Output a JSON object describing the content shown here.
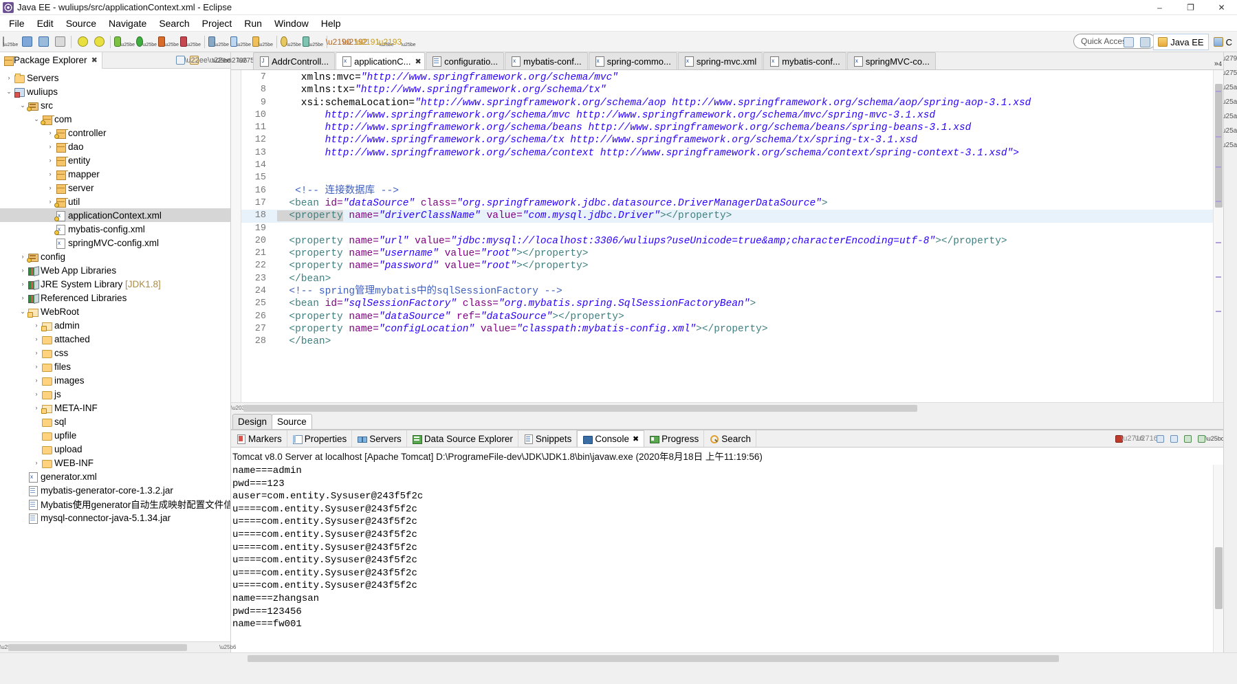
{
  "window": {
    "title": "Java EE - wuliups/src/applicationContext.xml - Eclipse",
    "icon": "eclipse-icon",
    "minimize": "–",
    "maximize": "❐",
    "close": "✕"
  },
  "menubar": {
    "items": [
      "File",
      "Edit",
      "Source",
      "Navigate",
      "Search",
      "Project",
      "Run",
      "Window",
      "Help"
    ]
  },
  "toolbar": {
    "quick_access_placeholder": "Quick Access",
    "perspective_java_ee": "Java EE",
    "perspective_other": "C"
  },
  "sidebar": {
    "view_tab": {
      "label": "Package Explorer",
      "close": "✖"
    },
    "tools": [
      "collapse-all",
      "link-with-editor",
      "view-menu-dots",
      "view-menu-chevron"
    ],
    "tree": [
      {
        "label": "Servers",
        "indent": 0,
        "twist": "›",
        "icon": "folder-open",
        "warn": false,
        "selected": false
      },
      {
        "label": "wuliups",
        "indent": 0,
        "twist": "⌄",
        "icon": "project",
        "warn": false,
        "selected": false
      },
      {
        "label": "src",
        "indent": 1,
        "twist": "⌄",
        "icon": "src-folder",
        "warn": true,
        "selected": false
      },
      {
        "label": "com",
        "indent": 2,
        "twist": "⌄",
        "icon": "package",
        "warn": true,
        "selected": false
      },
      {
        "label": "controller",
        "indent": 3,
        "twist": "›",
        "icon": "package",
        "warn": true,
        "selected": false
      },
      {
        "label": "dao",
        "indent": 3,
        "twist": "›",
        "icon": "package",
        "warn": false,
        "selected": false
      },
      {
        "label": "entity",
        "indent": 3,
        "twist": "›",
        "icon": "package",
        "warn": false,
        "selected": false
      },
      {
        "label": "mapper",
        "indent": 3,
        "twist": "›",
        "icon": "package-empty",
        "warn": false,
        "selected": false
      },
      {
        "label": "server",
        "indent": 3,
        "twist": "›",
        "icon": "package",
        "warn": false,
        "selected": false
      },
      {
        "label": "util",
        "indent": 3,
        "twist": "›",
        "icon": "package",
        "warn": true,
        "selected": false
      },
      {
        "label": "applicationContext.xml",
        "indent": 3,
        "twist": "",
        "icon": "xml-file",
        "warn": true,
        "selected": true
      },
      {
        "label": "mybatis-config.xml",
        "indent": 3,
        "twist": "",
        "icon": "xml-file",
        "warn": true,
        "selected": false
      },
      {
        "label": "springMVC-config.xml",
        "indent": 3,
        "twist": "",
        "icon": "xml-file",
        "warn": false,
        "selected": false
      },
      {
        "label": "config",
        "indent": 1,
        "twist": "›",
        "icon": "src-folder",
        "warn": true,
        "selected": false
      },
      {
        "label": "Web App Libraries",
        "indent": 1,
        "twist": "›",
        "icon": "library",
        "warn": false,
        "selected": false
      },
      {
        "label": "JRE System Library",
        "dim": " [JDK1.8]",
        "indent": 1,
        "twist": "›",
        "icon": "library",
        "warn": false,
        "selected": false
      },
      {
        "label": "Referenced Libraries",
        "indent": 1,
        "twist": "›",
        "icon": "library",
        "warn": false,
        "selected": false
      },
      {
        "label": "WebRoot",
        "indent": 1,
        "twist": "⌄",
        "icon": "folder-w",
        "warn": false,
        "selected": false
      },
      {
        "label": "admin",
        "indent": 2,
        "twist": "›",
        "icon": "folder-w",
        "warn": false,
        "selected": false
      },
      {
        "label": "attached",
        "indent": 2,
        "twist": "›",
        "icon": "folder",
        "warn": false,
        "selected": false
      },
      {
        "label": "css",
        "indent": 2,
        "twist": "›",
        "icon": "folder",
        "warn": false,
        "selected": false
      },
      {
        "label": "files",
        "indent": 2,
        "twist": "›",
        "icon": "folder",
        "warn": false,
        "selected": false
      },
      {
        "label": "images",
        "indent": 2,
        "twist": "›",
        "icon": "folder",
        "warn": false,
        "selected": false
      },
      {
        "label": "js",
        "indent": 2,
        "twist": "›",
        "icon": "folder",
        "warn": false,
        "selected": false
      },
      {
        "label": "META-INF",
        "indent": 2,
        "twist": "›",
        "icon": "folder-w",
        "warn": false,
        "selected": false
      },
      {
        "label": "sql",
        "indent": 2,
        "twist": "",
        "icon": "folder",
        "warn": false,
        "selected": false
      },
      {
        "label": "upfile",
        "indent": 2,
        "twist": "",
        "icon": "folder",
        "warn": false,
        "selected": false
      },
      {
        "label": "upload",
        "indent": 2,
        "twist": "",
        "icon": "folder",
        "warn": false,
        "selected": false
      },
      {
        "label": "WEB-INF",
        "indent": 2,
        "twist": "›",
        "icon": "folder",
        "warn": false,
        "selected": false
      },
      {
        "label": "generator.xml",
        "indent": 1,
        "twist": "",
        "icon": "xml-file",
        "warn": false,
        "selected": false
      },
      {
        "label": "mybatis-generator-core-1.3.2.jar",
        "indent": 1,
        "twist": "",
        "icon": "plain-file",
        "warn": false,
        "selected": false
      },
      {
        "label": "Mybatis使用generator自动生成映射配置文件信",
        "indent": 1,
        "twist": "",
        "icon": "plain-file",
        "warn": false,
        "selected": false
      },
      {
        "label": "mysql-connector-java-5.1.34.jar",
        "indent": 1,
        "twist": "",
        "icon": "plain-file",
        "warn": false,
        "selected": false
      }
    ]
  },
  "editor": {
    "tabs": [
      {
        "label": "AddrControll...",
        "icon": "java-file",
        "active": false,
        "closable": false
      },
      {
        "label": "applicationC...",
        "icon": "xml-file",
        "active": true,
        "closable": true
      },
      {
        "label": "configuratio...",
        "icon": "doc-file",
        "active": false,
        "closable": false
      },
      {
        "label": "mybatis-conf...",
        "icon": "xml-file",
        "active": false,
        "closable": false
      },
      {
        "label": "spring-commo...",
        "icon": "xml-file",
        "active": false,
        "closable": false
      },
      {
        "label": "spring-mvc.xml",
        "icon": "xml-file",
        "active": false,
        "closable": false
      },
      {
        "label": "mybatis-conf...",
        "icon": "xml-file",
        "active": false,
        "closable": false
      },
      {
        "label": "springMVC-co...",
        "icon": "xml-file",
        "active": false,
        "closable": false
      }
    ],
    "tab_overflow": "»",
    "tab_overflow_count": "4",
    "lines": [
      {
        "num": "7",
        "hl": false,
        "segs": [
          {
            "t": "plain",
            "s": "    xmlns:mvc="
          },
          {
            "t": "val",
            "s": "\"http://www.springframework.org/schema/mvc\""
          }
        ]
      },
      {
        "num": "8",
        "hl": false,
        "segs": [
          {
            "t": "plain",
            "s": "    xmlns:tx="
          },
          {
            "t": "val",
            "s": "\"http://www.springframework.org/schema/tx\""
          }
        ]
      },
      {
        "num": "9",
        "hl": false,
        "segs": [
          {
            "t": "plain",
            "s": "    xsi:schemaLocation="
          },
          {
            "t": "val",
            "s": "\"http://www.springframework.org/schema/aop http://www.springframework.org/schema/aop/spring-aop-3.1.xsd"
          }
        ]
      },
      {
        "num": "10",
        "hl": false,
        "segs": [
          {
            "t": "val",
            "s": "        http://www.springframework.org/schema/mvc http://www.springframework.org/schema/mvc/spring-mvc-3.1.xsd"
          }
        ]
      },
      {
        "num": "11",
        "hl": false,
        "segs": [
          {
            "t": "val",
            "s": "        http://www.springframework.org/schema/beans http://www.springframework.org/schema/beans/spring-beans-3.1.xsd"
          }
        ]
      },
      {
        "num": "12",
        "hl": false,
        "segs": [
          {
            "t": "val",
            "s": "        http://www.springframework.org/schema/tx http://www.springframework.org/schema/tx/spring-tx-3.1.xsd"
          }
        ]
      },
      {
        "num": "13",
        "hl": false,
        "segs": [
          {
            "t": "val",
            "s": "        http://www.springframework.org/schema/context http://www.springframework.org/schema/context/spring-context-3.1.xsd\">"
          }
        ]
      },
      {
        "num": "14",
        "hl": false,
        "segs": [
          {
            "t": "plain",
            "s": ""
          }
        ]
      },
      {
        "num": "15",
        "hl": false,
        "segs": [
          {
            "t": "plain",
            "s": ""
          }
        ]
      },
      {
        "num": "16",
        "hl": false,
        "segs": [
          {
            "t": "cmt",
            "s": "   <!-- 连接数据库 -->"
          }
        ]
      },
      {
        "num": "17",
        "hl": false,
        "segs": [
          {
            "t": "tag",
            "s": "  <bean "
          },
          {
            "t": "attr",
            "s": "id="
          },
          {
            "t": "val",
            "s": "\"dataSource\""
          },
          {
            "t": "attr",
            "s": " class="
          },
          {
            "t": "val",
            "s": "\"org.springframework.jdbc.datasource.DriverManagerDataSource\""
          },
          {
            "t": "tag",
            "s": ">"
          }
        ]
      },
      {
        "num": "18",
        "hl": true,
        "segs": [
          {
            "t": "tag occ",
            "s": "  <property"
          },
          {
            "t": "attr",
            "s": " name="
          },
          {
            "t": "val",
            "s": "\"driverClassName\""
          },
          {
            "t": "attr",
            "s": " value="
          },
          {
            "t": "val",
            "s": "\"com.mysql.jdbc.Driver\""
          },
          {
            "t": "tag",
            "s": "></property>"
          }
        ]
      },
      {
        "num": "19",
        "hl": false,
        "segs": [
          {
            "t": "plain",
            "s": ""
          }
        ]
      },
      {
        "num": "20",
        "hl": false,
        "segs": [
          {
            "t": "tag",
            "s": "  <property"
          },
          {
            "t": "attr",
            "s": " name="
          },
          {
            "t": "val",
            "s": "\"url\""
          },
          {
            "t": "attr",
            "s": " value="
          },
          {
            "t": "val",
            "s": "\"jdbc:mysql://localhost:3306/wuliups?useUnicode=true&amp;characterEncoding=utf-8\""
          },
          {
            "t": "tag",
            "s": "></property>"
          }
        ]
      },
      {
        "num": "21",
        "hl": false,
        "segs": [
          {
            "t": "tag",
            "s": "  <property"
          },
          {
            "t": "attr",
            "s": " name="
          },
          {
            "t": "val",
            "s": "\"username\""
          },
          {
            "t": "attr",
            "s": " value="
          },
          {
            "t": "val",
            "s": "\"root\""
          },
          {
            "t": "tag",
            "s": "></property>"
          }
        ]
      },
      {
        "num": "22",
        "hl": false,
        "segs": [
          {
            "t": "tag",
            "s": "  <property"
          },
          {
            "t": "attr",
            "s": " name="
          },
          {
            "t": "val",
            "s": "\"password\""
          },
          {
            "t": "attr",
            "s": " value="
          },
          {
            "t": "val",
            "s": "\"root\""
          },
          {
            "t": "tag",
            "s": "></property>"
          }
        ]
      },
      {
        "num": "23",
        "hl": false,
        "segs": [
          {
            "t": "tag",
            "s": "  </bean>"
          }
        ]
      },
      {
        "num": "24",
        "hl": false,
        "segs": [
          {
            "t": "cmt",
            "s": "  <!-- spring管理mybatis中的sqlSessionFactory -->"
          }
        ]
      },
      {
        "num": "25",
        "hl": false,
        "segs": [
          {
            "t": "tag",
            "s": "  <bean "
          },
          {
            "t": "attr",
            "s": "id="
          },
          {
            "t": "val",
            "s": "\"sqlSessionFactory\""
          },
          {
            "t": "attr",
            "s": " class="
          },
          {
            "t": "val",
            "s": "\"org.mybatis.spring.SqlSessionFactoryBean\""
          },
          {
            "t": "tag",
            "s": ">"
          }
        ]
      },
      {
        "num": "26",
        "hl": false,
        "segs": [
          {
            "t": "tag",
            "s": "  <property"
          },
          {
            "t": "attr",
            "s": " name="
          },
          {
            "t": "val",
            "s": "\"dataSource\""
          },
          {
            "t": "attr",
            "s": " ref="
          },
          {
            "t": "val",
            "s": "\"dataSource\""
          },
          {
            "t": "tag",
            "s": "></property>"
          }
        ]
      },
      {
        "num": "27",
        "hl": false,
        "segs": [
          {
            "t": "tag",
            "s": "  <property"
          },
          {
            "t": "attr",
            "s": " name="
          },
          {
            "t": "val",
            "s": "\"configLocation\""
          },
          {
            "t": "attr",
            "s": " value="
          },
          {
            "t": "val",
            "s": "\"classpath:mybatis-config.xml\""
          },
          {
            "t": "tag",
            "s": "></property>"
          }
        ]
      },
      {
        "num": "28",
        "hl": false,
        "segs": [
          {
            "t": "tag",
            "s": "  </bean>"
          }
        ]
      }
    ],
    "design_source_tabs": [
      {
        "label": "Design",
        "active": false
      },
      {
        "label": "Source",
        "active": true
      }
    ]
  },
  "console": {
    "tabs": [
      {
        "label": "Markers",
        "icon": "markers-icon",
        "active": false,
        "closable": false
      },
      {
        "label": "Properties",
        "icon": "properties-icon",
        "active": false,
        "closable": false
      },
      {
        "label": "Servers",
        "icon": "servers-icon",
        "active": false,
        "closable": false
      },
      {
        "label": "Data Source Explorer",
        "icon": "data-source-explorer-icon",
        "active": false,
        "closable": false
      },
      {
        "label": "Snippets",
        "icon": "snippets-icon",
        "active": false,
        "closable": false
      },
      {
        "label": "Console",
        "icon": "console-icon",
        "active": true,
        "closable": true
      },
      {
        "label": "Progress",
        "icon": "progress-icon",
        "active": false,
        "closable": false
      },
      {
        "label": "Search",
        "icon": "search-icon",
        "active": false,
        "closable": false
      }
    ],
    "header": "Tomcat v8.0 Server at localhost [Apache Tomcat] D:\\ProgrameFile-dev\\JDK\\JDK1.8\\bin\\javaw.exe (2020年8月18日 上午11:19:56)",
    "output": [
      "name===admin",
      "pwd===123",
      "auser=com.entity.Sysuser@243f5f2c",
      "u====com.entity.Sysuser@243f5f2c",
      "u====com.entity.Sysuser@243f5f2c",
      "u====com.entity.Sysuser@243f5f2c",
      "u====com.entity.Sysuser@243f5f2c",
      "u====com.entity.Sysuser@243f5f2c",
      "u====com.entity.Sysuser@243f5f2c",
      "u====com.entity.Sysuser@243f5f2c",
      "name===zhangsan",
      "pwd===123456",
      "name===fw001"
    ],
    "tools": [
      "terminate",
      "remove-launch",
      "remove-all-terminated",
      "scroll-lock",
      "pin-console",
      "display-selected-console",
      "open-console",
      "view-menu"
    ]
  }
}
